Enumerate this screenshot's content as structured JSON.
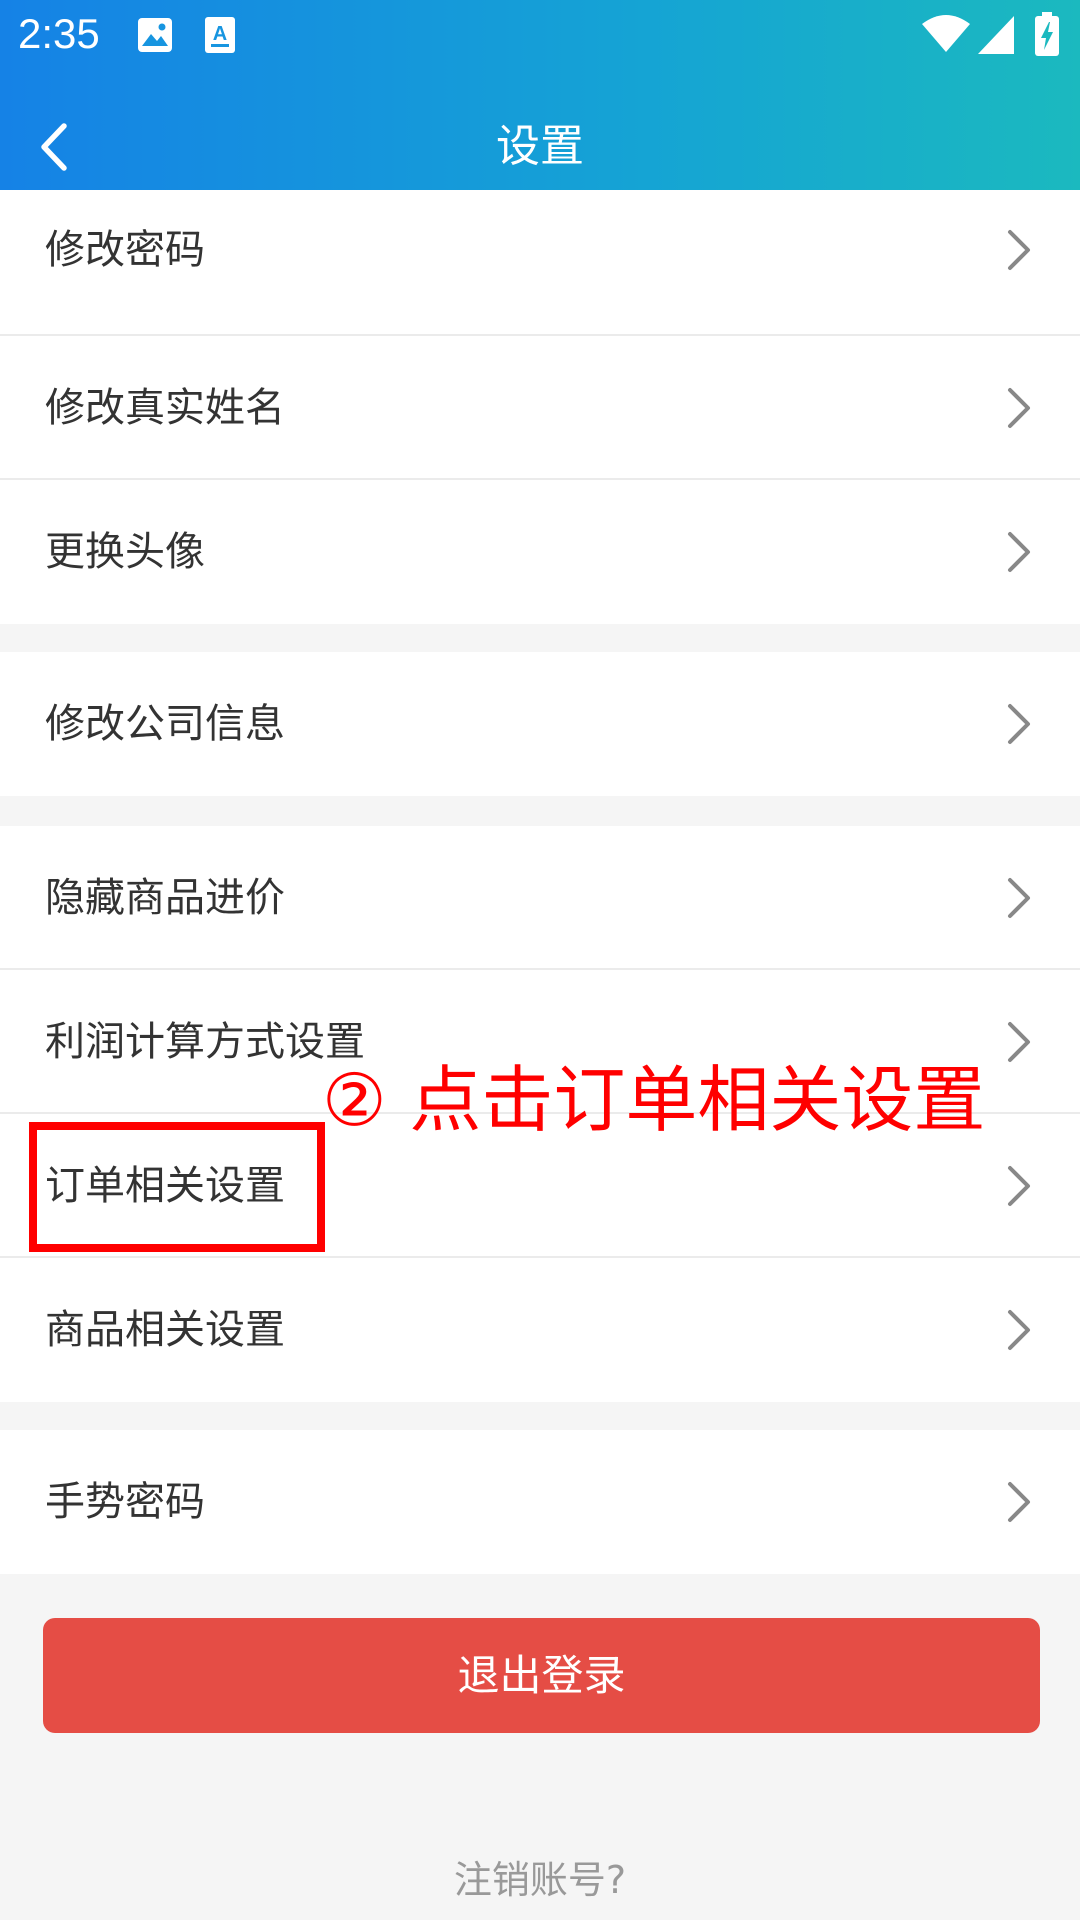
{
  "status_bar": {
    "time": "2:35",
    "icons": [
      "image-icon",
      "a-text-icon",
      "wifi-icon",
      "signal-icon",
      "battery-charging-icon"
    ]
  },
  "header": {
    "title": "设置",
    "back_icon": "chevron-left-icon"
  },
  "settings": {
    "items": [
      {
        "label": "修改密码"
      },
      {
        "label": "修改真实姓名"
      },
      {
        "label": "更换头像"
      },
      {
        "label": "修改公司信息"
      },
      {
        "label": "隐藏商品进价"
      },
      {
        "label": "利润计算方式设置"
      },
      {
        "label": "订单相关设置"
      },
      {
        "label": "商品相关设置"
      },
      {
        "label": "手势密码"
      }
    ],
    "chevron_icon": "chevron-right-icon"
  },
  "annotation": {
    "text": "② 点击订单相关设置",
    "color": "#ff0000"
  },
  "actions": {
    "logout_label": "退出登录",
    "delete_account_label": "注销账号?"
  },
  "colors": {
    "header_start": "#1582e6",
    "header_end": "#1bb9bf",
    "logout": "#e54d45",
    "background": "#f5f5f5"
  }
}
